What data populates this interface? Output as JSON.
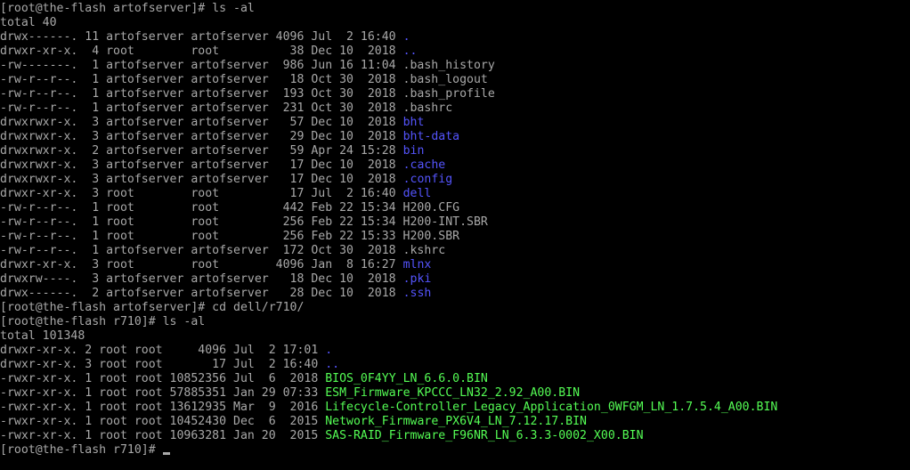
{
  "terminal": {
    "colors": {
      "background": "#000000",
      "foreground": "#a8a8a8",
      "directory": "#5454fc",
      "executable": "#54fc54"
    },
    "lines": [
      {
        "segments": [
          {
            "text": "[root@the-flash artofserver]# ls -al",
            "color": "default"
          }
        ]
      },
      {
        "segments": [
          {
            "text": "total 40",
            "color": "default"
          }
        ]
      },
      {
        "segments": [
          {
            "text": "drwx------. 11 artofserver artofserver 4096 Jul  2 16:40 ",
            "color": "default"
          },
          {
            "text": ".",
            "color": "dir"
          }
        ]
      },
      {
        "segments": [
          {
            "text": "drwxr-xr-x.  4 root        root          38 Dec 10  2018 ",
            "color": "default"
          },
          {
            "text": "..",
            "color": "dir"
          }
        ]
      },
      {
        "segments": [
          {
            "text": "-rw-------.  1 artofserver artofserver  986 Jun 16 11:04 .bash_history",
            "color": "default"
          }
        ]
      },
      {
        "segments": [
          {
            "text": "-rw-r--r--.  1 artofserver artofserver   18 Oct 30  2018 .bash_logout",
            "color": "default"
          }
        ]
      },
      {
        "segments": [
          {
            "text": "-rw-r--r--.  1 artofserver artofserver  193 Oct 30  2018 .bash_profile",
            "color": "default"
          }
        ]
      },
      {
        "segments": [
          {
            "text": "-rw-r--r--.  1 artofserver artofserver  231 Oct 30  2018 .bashrc",
            "color": "default"
          }
        ]
      },
      {
        "segments": [
          {
            "text": "drwxrwxr-x.  3 artofserver artofserver   57 Dec 10  2018 ",
            "color": "default"
          },
          {
            "text": "bht",
            "color": "dir"
          }
        ]
      },
      {
        "segments": [
          {
            "text": "drwxrwxr-x.  3 artofserver artofserver   29 Dec 10  2018 ",
            "color": "default"
          },
          {
            "text": "bht-data",
            "color": "dir"
          }
        ]
      },
      {
        "segments": [
          {
            "text": "drwxrwxr-x.  2 artofserver artofserver   59 Apr 24 15:28 ",
            "color": "default"
          },
          {
            "text": "bin",
            "color": "dir"
          }
        ]
      },
      {
        "segments": [
          {
            "text": "drwxrwxr-x.  3 artofserver artofserver   17 Dec 10  2018 ",
            "color": "default"
          },
          {
            "text": ".cache",
            "color": "dir"
          }
        ]
      },
      {
        "segments": [
          {
            "text": "drwxrwxr-x.  3 artofserver artofserver   17 Dec 10  2018 ",
            "color": "default"
          },
          {
            "text": ".config",
            "color": "dir"
          }
        ]
      },
      {
        "segments": [
          {
            "text": "drwxr-xr-x.  3 root        root          17 Jul  2 16:40 ",
            "color": "default"
          },
          {
            "text": "dell",
            "color": "dir"
          }
        ]
      },
      {
        "segments": [
          {
            "text": "-rw-r--r--.  1 root        root         442 Feb 22 15:34 H200.CFG",
            "color": "default"
          }
        ]
      },
      {
        "segments": [
          {
            "text": "-rw-r--r--.  1 root        root         256 Feb 22 15:34 H200-INT.SBR",
            "color": "default"
          }
        ]
      },
      {
        "segments": [
          {
            "text": "-rw-r--r--.  1 root        root         256 Feb 22 15:33 H200.SBR",
            "color": "default"
          }
        ]
      },
      {
        "segments": [
          {
            "text": "-rw-r--r--.  1 artofserver artofserver  172 Oct 30  2018 .kshrc",
            "color": "default"
          }
        ]
      },
      {
        "segments": [
          {
            "text": "drwxr-xr-x.  3 root        root        4096 Jan  8 16:27 ",
            "color": "default"
          },
          {
            "text": "mlnx",
            "color": "dir"
          }
        ]
      },
      {
        "segments": [
          {
            "text": "drwxrw----.  3 artofserver artofserver   18 Dec 10  2018 ",
            "color": "default"
          },
          {
            "text": ".pki",
            "color": "dir"
          }
        ]
      },
      {
        "segments": [
          {
            "text": "drwx------.  2 artofserver artofserver   28 Dec 10  2018 ",
            "color": "default"
          },
          {
            "text": ".ssh",
            "color": "dir"
          }
        ]
      },
      {
        "segments": [
          {
            "text": "[root@the-flash artofserver]# cd dell/r710/",
            "color": "default"
          }
        ]
      },
      {
        "segments": [
          {
            "text": "[root@the-flash r710]# ls -al",
            "color": "default"
          }
        ]
      },
      {
        "segments": [
          {
            "text": "total 101348",
            "color": "default"
          }
        ]
      },
      {
        "segments": [
          {
            "text": "drwxr-xr-x. 2 root root     4096 Jul  2 17:01 ",
            "color": "default"
          },
          {
            "text": ".",
            "color": "dir"
          }
        ]
      },
      {
        "segments": [
          {
            "text": "drwxr-xr-x. 3 root root       17 Jul  2 16:40 ",
            "color": "default"
          },
          {
            "text": "..",
            "color": "dir"
          }
        ]
      },
      {
        "segments": [
          {
            "text": "-rwxr-xr-x. 1 root root 10852356 Jul  6  2018 ",
            "color": "default"
          },
          {
            "text": "BIOS_0F4YY_LN_6.6.0.BIN",
            "color": "exec"
          }
        ]
      },
      {
        "segments": [
          {
            "text": "-rwxr-xr-x. 1 root root 57885351 Jan 29 07:33 ",
            "color": "default"
          },
          {
            "text": "ESM_Firmware_KPCCC_LN32_2.92_A00.BIN",
            "color": "exec"
          }
        ]
      },
      {
        "segments": [
          {
            "text": "-rwxr-xr-x. 1 root root 13612935 Mar  9  2016 ",
            "color": "default"
          },
          {
            "text": "Lifecycle-Controller_Legacy_Application_0WFGM_LN_1.7.5.4_A00.BIN",
            "color": "exec"
          }
        ]
      },
      {
        "segments": [
          {
            "text": "-rwxr-xr-x. 1 root root 10452430 Dec  6  2015 ",
            "color": "default"
          },
          {
            "text": "Network_Firmware_PX6V4_LN_7.12.17.BIN",
            "color": "exec"
          }
        ]
      },
      {
        "segments": [
          {
            "text": "-rwxr-xr-x. 1 root root 10963281 Jan 20  2015 ",
            "color": "default"
          },
          {
            "text": "SAS-RAID_Firmware_F96NR_LN_6.3.3-0002_X00.BIN",
            "color": "exec"
          }
        ]
      },
      {
        "segments": [
          {
            "text": "[root@the-flash r710]#",
            "color": "default"
          }
        ],
        "cursor": true
      }
    ]
  }
}
